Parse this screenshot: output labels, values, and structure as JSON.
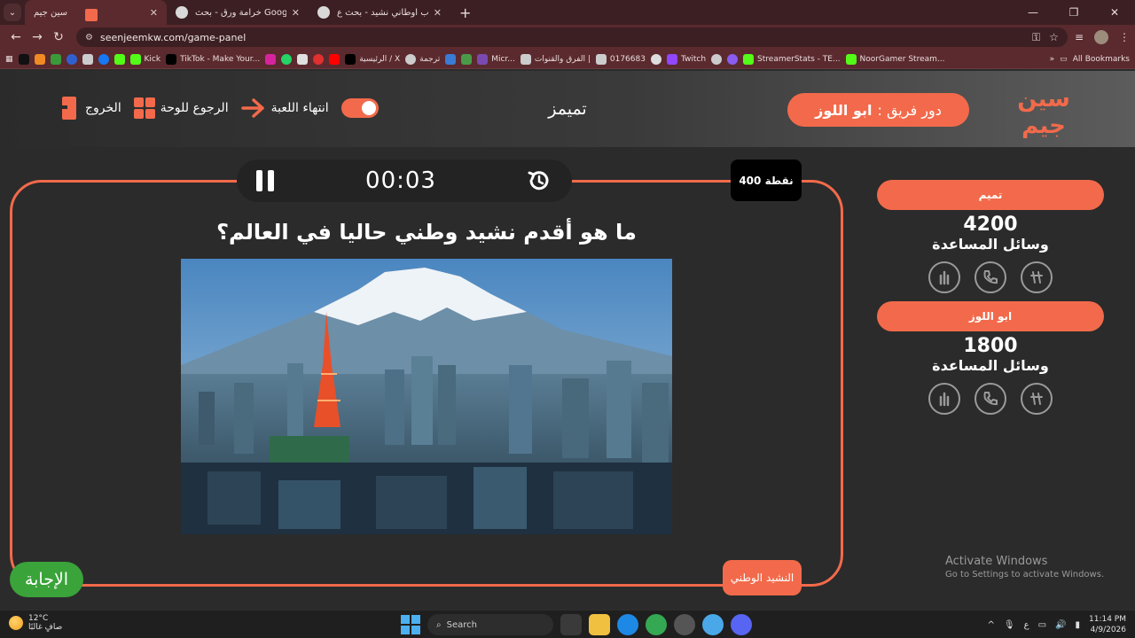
{
  "browser": {
    "tabs": [
      {
        "title": "سين جيم",
        "active": true
      },
      {
        "title": "خرامة ورق - بحث Google",
        "active": false
      },
      {
        "title": "بلاد العرب اوطاني نشيد - بحث ع",
        "active": false
      }
    ],
    "url": "seenjeemkw.com/game-panel",
    "bookmarks": [
      "Kick",
      "TikTok - Make Your...",
      "الرئيسية / X",
      "ترجمة",
      "Micr...",
      "الفرق والقنوات |",
      "0176683",
      "Twitch",
      "StreamerStats - TE...",
      "NoorGamer Stream..."
    ],
    "all_bookmarks_label": "All Bookmarks"
  },
  "header": {
    "logo_text": "سين جيم",
    "turn_prefix": "دور فريق :",
    "turn_team": "ابو اللوز",
    "game_name": "تميمز",
    "end_game_label": "انتهاء اللعبة",
    "back_to_board_label": "الرجوع للوحة",
    "exit_label": "الخروج"
  },
  "board": {
    "timer": "00:03",
    "points": "400 نقطة",
    "question": "ما هو أقدم نشيد وطني حاليا في العالم؟",
    "category": "النشيد الوطني",
    "answer_label": "الإجابة"
  },
  "teams": [
    {
      "name": "تميم",
      "score": "4200",
      "aids_label": "وسائل المساعدة"
    },
    {
      "name": "ابو اللوز",
      "score": "1800",
      "aids_label": "وسائل المساعدة"
    }
  ],
  "watermark": {
    "line1": "Activate Windows",
    "line2": "Go to Settings to activate Windows."
  },
  "taskbar": {
    "temp": "12°C",
    "weather": "صافٍ غالبًا",
    "search_label": "Search",
    "time": "11:14 PM",
    "date": "4/9/2026"
  },
  "colors": {
    "accent": "#f26a4b",
    "answer": "#3aa33a",
    "bg": "#2b2b2b"
  }
}
